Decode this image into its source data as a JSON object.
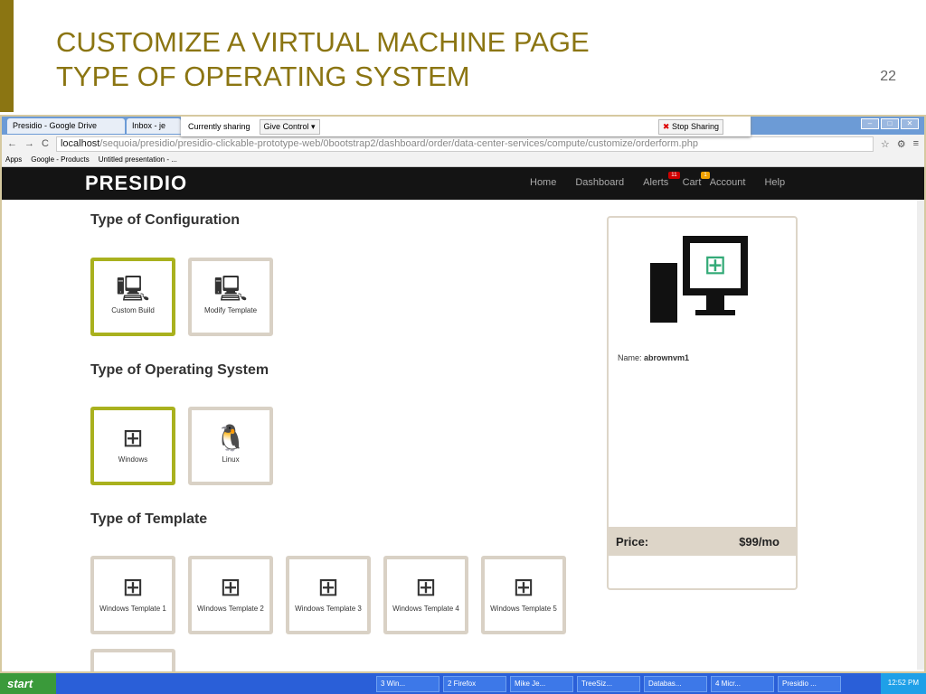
{
  "slide": {
    "title1": "CUSTOMIZE A VIRTUAL MACHINE PAGE",
    "title2": "TYPE OF OPERATING SYSTEM",
    "page": "22"
  },
  "browser": {
    "tabs": [
      "Presidio - Google Drive",
      "Inbox - je"
    ],
    "sharing": "Currently sharing",
    "give_control": "Give Control ▾",
    "stop_sharing": "Stop Sharing",
    "url_host": "localhost",
    "url_path": "/sequoia/presidio/presidio-clickable-prototype-web/0bootstrap2/dashboard/order/data-center-services/compute/customize/orderform.php",
    "bookmarks": [
      "Apps",
      "Google - Products",
      "Untitled presentation - ..."
    ]
  },
  "nav": {
    "logo": "PRESIDIO",
    "items": [
      "Home",
      "Dashboard",
      "Alerts",
      "Cart",
      "Account",
      "Help"
    ],
    "alerts_count": "11",
    "cart_count": "1",
    "colors": {
      "alerts": "#cc0000",
      "cart": "#f0a000"
    }
  },
  "config": {
    "heading": "Type of Configuration",
    "options": [
      "Custom Build",
      "Modify Template"
    ],
    "selected": 0
  },
  "os": {
    "heading": "Type of Operating System",
    "options": [
      "Windows",
      "Linux"
    ],
    "selected": 0
  },
  "template": {
    "heading": "Type of Template",
    "options": [
      "Windows Template 1",
      "Windows Template 2",
      "Windows Template 3",
      "Windows Template 4",
      "Windows Template 5"
    ]
  },
  "summary": {
    "name_label": "Name:",
    "name_value": "abrownvm1",
    "price_label": "Price:",
    "price_value": "$99/mo"
  },
  "taskbar": {
    "start": "start",
    "items": [
      "3 Win...",
      "2 Firefox",
      "Mike Je...",
      "TreeSiz...",
      "Databas...",
      "4 Micr...",
      "Presidio ..."
    ],
    "time": "12:52 PM"
  }
}
